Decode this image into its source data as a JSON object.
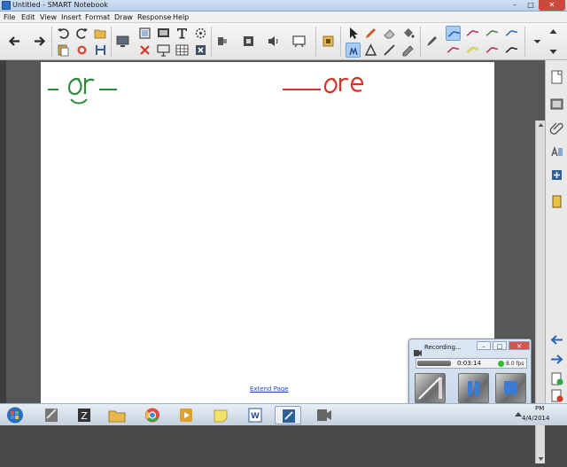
{
  "window": {
    "title": "Untitled - SMART Notebook",
    "minimize": "–",
    "maximize": "□",
    "close": "✕"
  },
  "menu": {
    "items": [
      "File",
      "Edit",
      "View",
      "Insert",
      "Format",
      "Draw",
      "Response",
      "Help"
    ]
  },
  "toolbar": {
    "icons": [
      "back-arrow-icon",
      "forward-arrow-icon",
      "undo-icon",
      "redo-icon",
      "open-file-icon",
      "save-icon",
      "paste-icon",
      "delete-icon",
      "screen-shade-icon",
      "full-screen-icon",
      "display-icon",
      "capture-icon",
      "table-icon",
      "close-page-icon",
      "document-camera-icon",
      "record-icon",
      "sound-icon",
      "screen-capture-icon",
      "magic-icon",
      "select-icon",
      "pen-icon",
      "creative-pen-icon",
      "eraser-icon",
      "shape-icon",
      "line-icon",
      "fill-icon",
      "highlighter-icon"
    ],
    "pen_colors": [
      "#1e63c8",
      "#c2185b",
      "#3a7d3a",
      "#1e63c8",
      "#c2185b",
      "#d4d46a",
      "#c2185b",
      "#111111"
    ]
  },
  "canvas": {
    "ink": [
      {
        "text": "or",
        "color": "#2e8b3a"
      },
      {
        "text": "ore",
        "color": "#d93025"
      }
    ],
    "extend_link": "Extend Page"
  },
  "recording": {
    "title": "Recording...",
    "time": "0:03:14",
    "fps": "8.0 fps",
    "status_color": "#2dbd2d"
  },
  "taskbar": {
    "apps": [
      "start-orb-icon",
      "notebook-icon",
      "zoomit-icon",
      "explorer-icon",
      "chrome-icon",
      "media-player-icon",
      "sticky-notes-icon",
      "word-icon",
      "smart-notebook-icon",
      "recorder-icon"
    ],
    "time": "PM",
    "date": "4/4/2014"
  }
}
